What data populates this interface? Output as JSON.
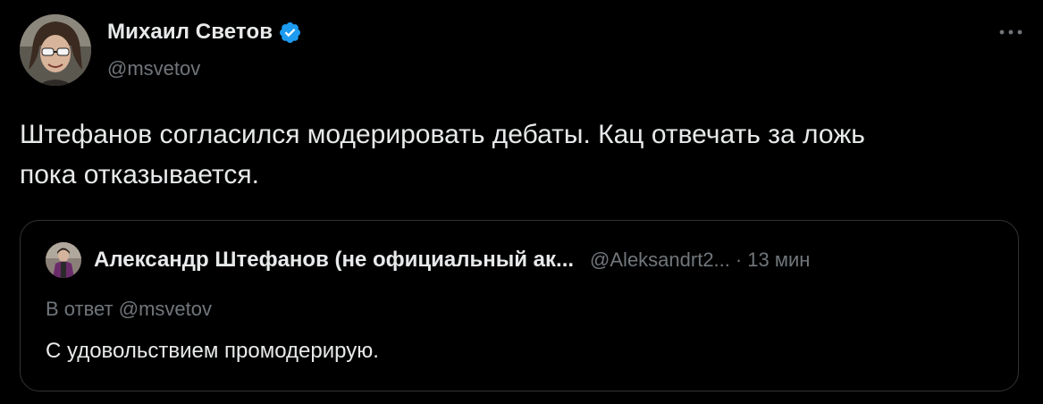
{
  "tweet": {
    "author": {
      "name": "Михаил Светов",
      "handle": "@msvetov",
      "verified": true,
      "verified_color": "#1d9bf0"
    },
    "text_line1": "Штефанов согласился модерировать дебаты. Кац отвечать за ложь",
    "text_line2": "пока отказывается.",
    "more_icon": "more-horizontal-icon"
  },
  "quote": {
    "author_name": "Александр Штефанов (не официальный ак...",
    "author_handle": "@Aleksandrt2...",
    "separator": "·",
    "time": "13 мин",
    "reply_prefix": "В ответ",
    "reply_handle": "@msvetov",
    "text": "С удовольствием промодерирую."
  },
  "colors": {
    "background": "#000000",
    "primary_text": "#e7e9ea",
    "secondary_text": "#71767b",
    "border": "#2f3336",
    "accent": "#1d9bf0"
  }
}
